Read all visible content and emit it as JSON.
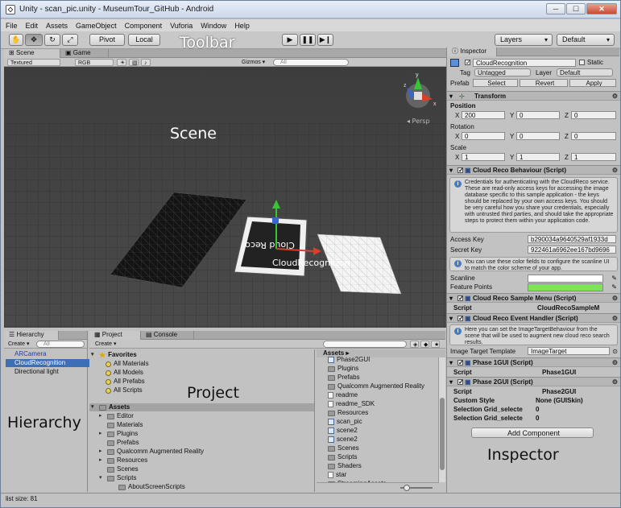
{
  "window": {
    "title": "Unity - scan_pic.unity - MuseumTour_GitHub - Android",
    "minimize": "─",
    "maximize": "☐",
    "close": "✕"
  },
  "menu": [
    "File",
    "Edit",
    "Assets",
    "GameObject",
    "Component",
    "Vuforia",
    "Window",
    "Help"
  ],
  "toolbar": {
    "pivot": "Pivot",
    "local": "Local",
    "layers": "Layers",
    "layout": "Default"
  },
  "annotations": {
    "toolbar": "Toolbar",
    "scene": "Scene",
    "project": "Project",
    "hierarchy": "Hierarchy",
    "inspector": "Inspector"
  },
  "scene": {
    "tab_scene": "Scene",
    "tab_game": "Game",
    "shading": "Textured",
    "render": "RGB",
    "gizmos": "Gizmos ▾",
    "search_placeholder": "All",
    "persp": "◂ Persp",
    "overlay_label": "CloudRecognition",
    "axis_x": "x",
    "axis_y": "y",
    "axis_z": "z",
    "marker_text": "Cloud Reco"
  },
  "hierarchy": {
    "tab": "Hierarchy",
    "create": "Create ▾",
    "search": "All",
    "items": [
      "ARCamera",
      "CloudRecognition",
      "Directional light"
    ],
    "selected": 1
  },
  "project": {
    "tab_project": "Project",
    "tab_console": "Console",
    "create": "Create ▾",
    "favorites": "Favorites",
    "fav_items": [
      "All Materials",
      "All Models",
      "All Prefabs",
      "All Scripts"
    ],
    "assets": "Assets",
    "tree": [
      "Editor",
      "Materials",
      "Plugins",
      "Prefabs",
      "Qualcomm Augmented Reality",
      "Resources",
      "Scenes",
      "Scripts",
      "AboutScreenScripts"
    ],
    "breadcrumb": "Assets ▸",
    "files": [
      "Phase2GUI",
      "Plugins",
      "Prefabs",
      "Qualcomm Augmented Reality",
      "readme",
      "readme_SDK",
      "Resources",
      "scan_pic",
      "scene2",
      "scene2",
      "Scenes",
      "Scripts",
      "Shaders",
      "star",
      "StreamingAssets"
    ]
  },
  "inspector": {
    "tab": "Inspector",
    "object_name": "CloudRecognition",
    "static": "Static",
    "tag_label": "Tag",
    "tag": "Untagged",
    "layer_label": "Layer",
    "layer": "Default",
    "prefab_label": "Prefab",
    "select": "Select",
    "revert": "Revert",
    "apply": "Apply",
    "transform": "Transform",
    "position": "Position",
    "rotation": "Rotation",
    "scale": "Scale",
    "pos": [
      "200",
      "0",
      "0"
    ],
    "rot": [
      "0",
      "0",
      "0"
    ],
    "scl": [
      "1",
      "1",
      "1"
    ],
    "x": "X",
    "y": "Y",
    "z": "Z",
    "cloud_reco": "Cloud Reco Behaviour (Script)",
    "cloud_reco_note": "Credentials for authenticating with the CloudReco service. These are read-only access keys for accessing the image database specific to this sample application - the keys should be replaced by your own access keys. You should be very careful how you share your credentials, especially with untrusted third parties, and should take the appropriate steps to protect them within your application code.",
    "access_key_label": "Access Key",
    "access_key": "b290034a9640529af1933d",
    "secret_key_label": "Secret Key",
    "secret_key": "922461a6962ee167bd9696",
    "color_note": "You can use these color fields to configure the scanline UI to match the color scheme of your app.",
    "scanline_label": "Scanline",
    "feature_points_label": "Feature Points",
    "scanline_color": "#ffffff",
    "feature_color": "#7fe35a",
    "sample_menu": "Cloud Reco Sample Menu (Script)",
    "script_label": "Script",
    "sample_menu_script": "CloudRecoSampleM",
    "event_handler": "Cloud Reco Event Handler (Script)",
    "event_note": "Here you can set the ImageTargetBehaviour from the scene that will be used to augment new cloud reco search results.",
    "image_target_template": "Image Target Template",
    "image_target_value": "ImageTarget",
    "phase1": "Phase 1GUI (Script)",
    "phase1_script": "Phase1GUI",
    "phase2": "Phase 2GUI (Script)",
    "phase2_script": "Phase2GUI",
    "custom_style": "Custom Style",
    "custom_style_value": "None (GUISkin)",
    "grid1": "Selection Grid_selecte",
    "grid1_value": "0",
    "grid2": "Selection Grid_selecte",
    "grid2_value": "0",
    "add_component": "Add Component"
  },
  "status": {
    "list_size": "list size: 81"
  }
}
